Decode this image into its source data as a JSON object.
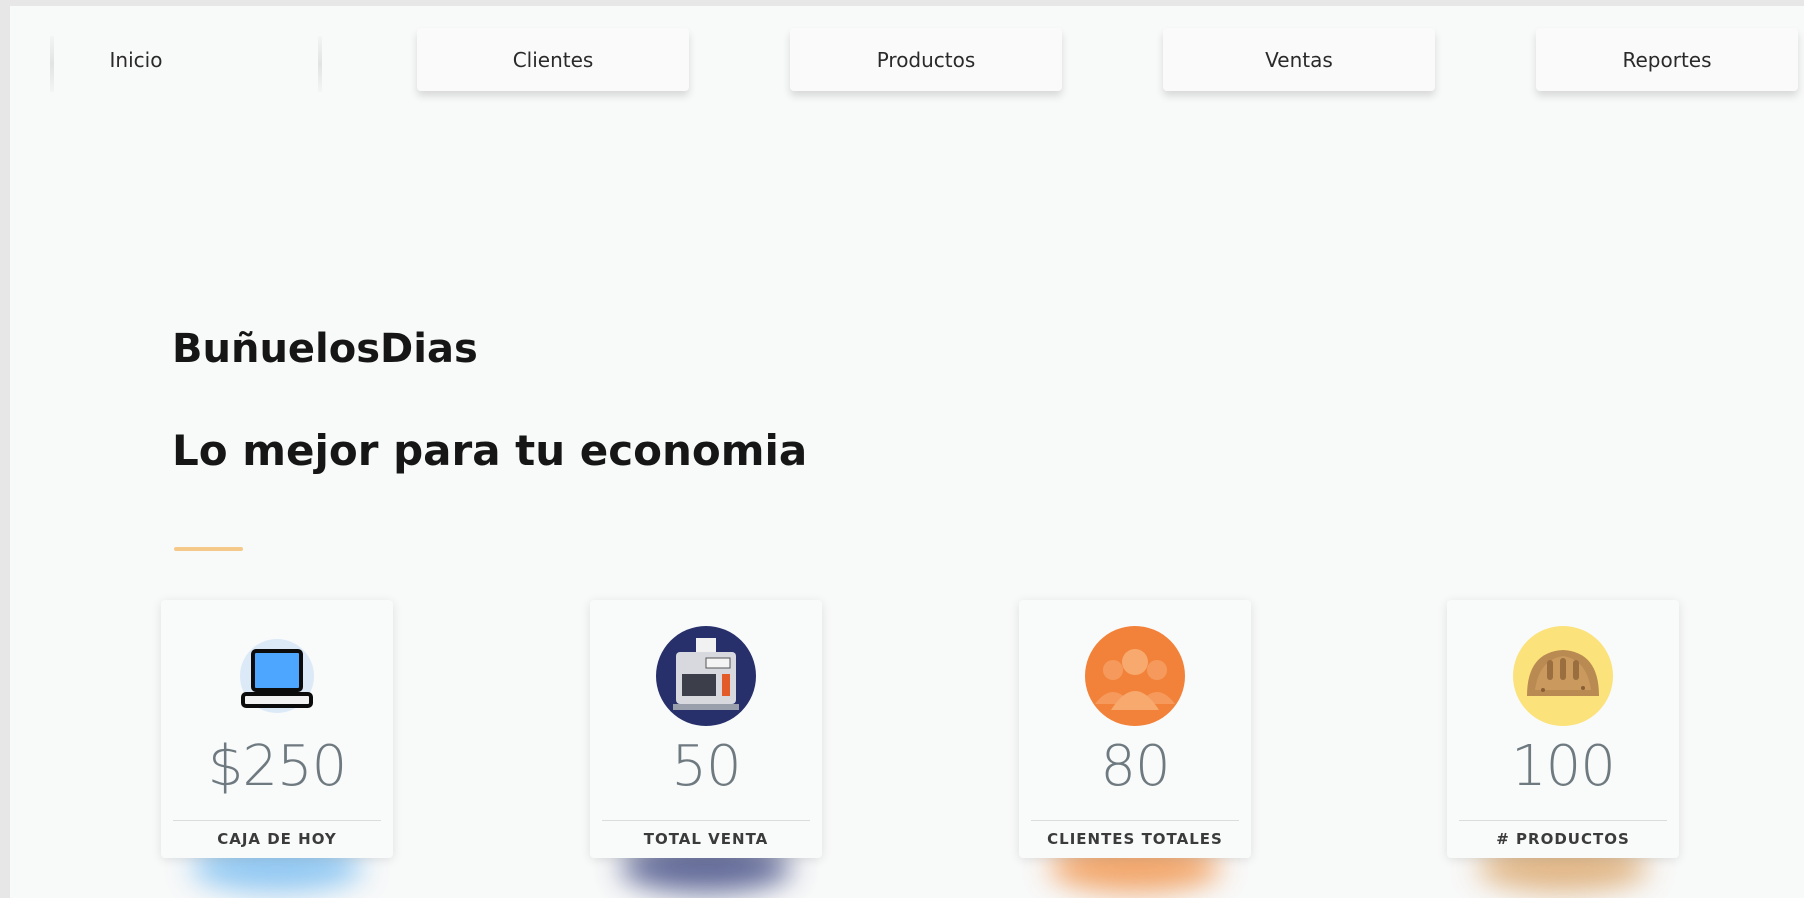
{
  "nav": {
    "items": [
      {
        "label": "Inicio"
      },
      {
        "label": "Clientes"
      },
      {
        "label": "Productos"
      },
      {
        "label": "Ventas"
      },
      {
        "label": "Reportes"
      }
    ]
  },
  "hero": {
    "brand": "BuñuelosDias",
    "tagline": "Lo mejor para tu economia",
    "accent_color": "#f5c98a"
  },
  "stats": [
    {
      "icon": "laptop-icon",
      "value": "$250",
      "label": "CAJA DE HOY",
      "glow_color": "#6fb8f0"
    },
    {
      "icon": "cash-register-icon",
      "value": "50",
      "label": "TOTAL VENTA",
      "glow_color": "#2f3a78"
    },
    {
      "icon": "users-icon",
      "value": "80",
      "label": "CLIENTES TOTALES",
      "glow_color": "#f08a3a"
    },
    {
      "icon": "bread-icon",
      "value": "100",
      "label": "# PRODUCTOS",
      "glow_color": "#d9a060"
    }
  ]
}
